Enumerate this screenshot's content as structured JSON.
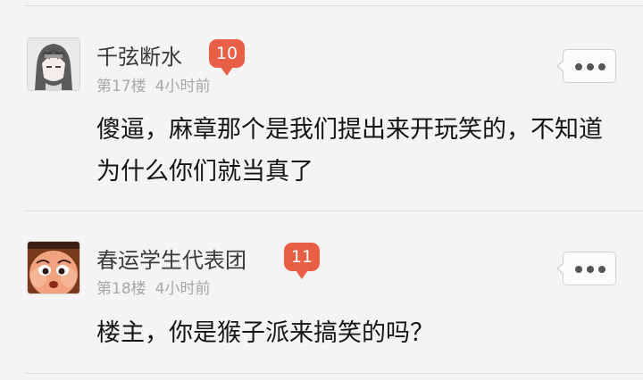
{
  "posts": [
    {
      "username": "千弦断水",
      "level": "10",
      "floor": "第17楼",
      "time": "4小时前",
      "content": "傻逼，麻章那个是我们提出来开玩笑的，不知道为什么你们就当真了"
    },
    {
      "username": "春运学生代表团",
      "level": "11",
      "floor": "第18楼",
      "time": "4小时前",
      "content": "楼主，你是猴子派来搞笑的吗？"
    }
  ],
  "icons": {
    "avatar_1": "anime-character-avatar",
    "avatar_2": "cartoon-baby-avatar",
    "more": "more-options-icon"
  },
  "colors": {
    "badge": "#e95f45",
    "meta_text": "#a8a8a8",
    "content_text": "#151515"
  }
}
